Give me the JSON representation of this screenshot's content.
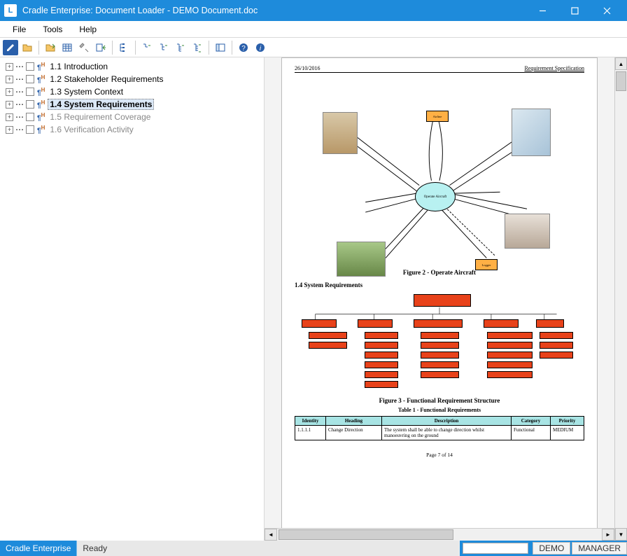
{
  "window": {
    "title": "Cradle Enterprise: Document Loader - DEMO Document.doc",
    "app_icon_letter": "L"
  },
  "menu": {
    "file": "File",
    "tools": "Tools",
    "help": "Help"
  },
  "tree": {
    "items": [
      {
        "num": "1.1",
        "label": "Introduction",
        "selected": false,
        "dim": false
      },
      {
        "num": "1.2",
        "label": "Stakeholder Requirements",
        "selected": false,
        "dim": false
      },
      {
        "num": "1.3",
        "label": "System Context",
        "selected": false,
        "dim": false
      },
      {
        "num": "1.4",
        "label": "System Requirements",
        "selected": true,
        "dim": false
      },
      {
        "num": "1.5",
        "label": "Requirement Coverage",
        "selected": false,
        "dim": true
      },
      {
        "num": "1.6",
        "label": "Verification Activity",
        "selected": false,
        "dim": true
      }
    ]
  },
  "doc": {
    "date": "26/10/2016",
    "header_right": "Requirement Specification",
    "oval_label": "Operate Aircraft",
    "figure2": "Figure 2 - Operate Aircraft",
    "section": "1.4  System Requirements",
    "figure3": "Figure 3 - Functional Requirement Structure",
    "table_title": "Table 1 - Functional Requirements",
    "table": {
      "headers": [
        "Identity",
        "Heading",
        "Description",
        "Category",
        "Priority"
      ],
      "row": {
        "identity": "1.1.1.1",
        "heading": "Change Direction",
        "description": "The system shall be able to change direction whilst manoeuvring on the ground",
        "category": "Functional",
        "priority": "MEDIUM"
      }
    },
    "page_no": "Page 7 of 14"
  },
  "status": {
    "left": "Cradle Enterprise",
    "ready": "Ready",
    "demo": "DEMO",
    "manager": "MANAGER"
  }
}
